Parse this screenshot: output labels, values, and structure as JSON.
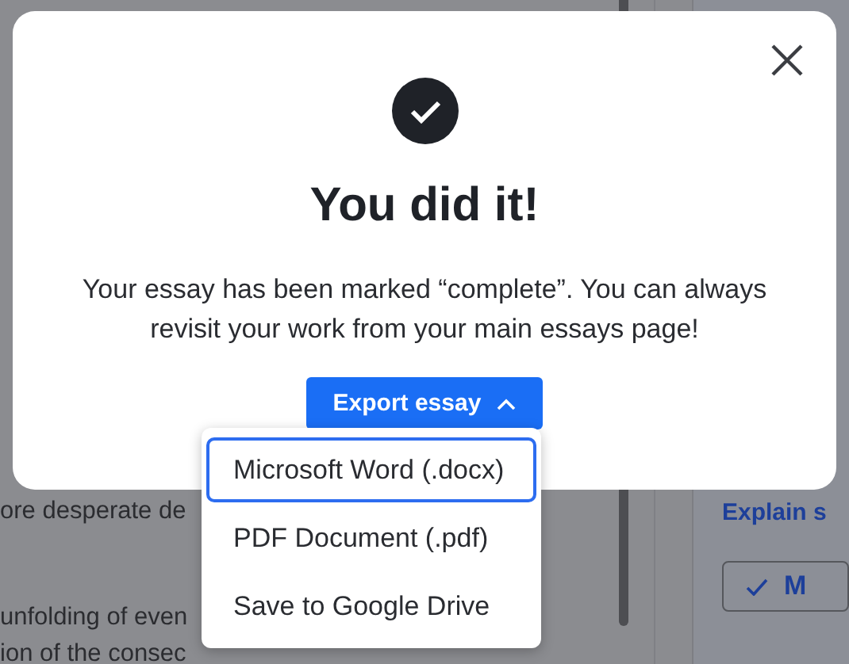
{
  "background": {
    "left_lines": [
      "ore desperate de",
      "unfolding of even",
      "ion of the consec"
    ],
    "link": "Explain s",
    "button": "M"
  },
  "modal": {
    "title": "You did it!",
    "message": "Your essay has been marked “complete”. You can always revisit your work from your main essays page!",
    "export_button": {
      "label": "Export essay",
      "expanded": true
    },
    "menu": [
      {
        "label": "Microsoft Word (.docx)",
        "selected": true
      },
      {
        "label": "PDF Document (.pdf)",
        "selected": false
      },
      {
        "label": "Save to Google Drive",
        "selected": false
      }
    ]
  }
}
